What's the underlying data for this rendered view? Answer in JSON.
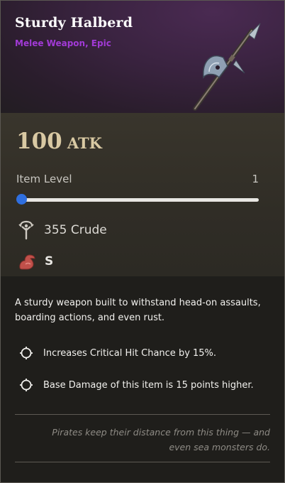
{
  "item": {
    "name": "Sturdy Halberd",
    "subtitle": "Melee Weapon, Epic",
    "image_icon": "halberd-icon"
  },
  "stats": {
    "atk_value": "100",
    "atk_unit": "ATK",
    "item_level_label": "Item Level",
    "item_level_value": "1",
    "item_level_fraction": 0,
    "crude_text": "355 Crude",
    "crude_icon": "crude-material-icon",
    "strength_grade": "S",
    "strength_icon": "flexed-arm-icon"
  },
  "description": "A sturdy weapon built to withstand head-on assaults, boarding actions, and even rust.",
  "effects": [
    {
      "text": "Increases Critical Hit Chance by 15%.",
      "icon": "target-circle-icon"
    },
    {
      "text": "Base Damage of this item is 15 points higher.",
      "icon": "target-circle-icon"
    }
  ],
  "flavor_text": "Pirates keep their distance from this thing — and even sea monsters do.",
  "colors": {
    "rarity_epic": "#a13ad6",
    "atk_gold": "#d9c9a3",
    "slider_thumb": "#2f6fe0",
    "strength_red": "#c0504a"
  }
}
